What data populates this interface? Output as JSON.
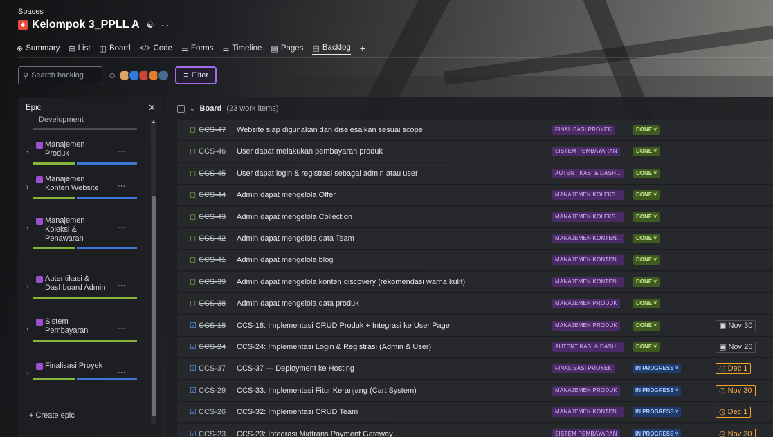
{
  "header": {
    "breadcrumb": "Spaces",
    "project_name": "Kelompok 3_PPLL A",
    "tabs": [
      {
        "label": "Summary",
        "icon": "globe-icon",
        "glyph": "⊕"
      },
      {
        "label": "List",
        "icon": "list-icon",
        "glyph": "⊟"
      },
      {
        "label": "Board",
        "icon": "board-icon",
        "glyph": "◫"
      },
      {
        "label": "Code",
        "icon": "code-icon",
        "glyph": "</>"
      },
      {
        "label": "Forms",
        "icon": "forms-icon",
        "glyph": "☰"
      },
      {
        "label": "Timeline",
        "icon": "timeline-icon",
        "glyph": "☰"
      },
      {
        "label": "Pages",
        "icon": "pages-icon",
        "glyph": "▤"
      },
      {
        "label": "Backlog",
        "icon": "backlog-icon",
        "glyph": "▤"
      }
    ]
  },
  "toolbar": {
    "search_placeholder": "Search backlog",
    "filter_label": "Filter"
  },
  "epic_panel": {
    "title": "Epic",
    "partial_label": "Development",
    "items": [
      {
        "label": "Manajemen Produk",
        "full": false
      },
      {
        "label": "Manajemen Konten Website",
        "full": false
      },
      {
        "label": "Manajemen Koleksi & Penawaran",
        "full": false
      },
      {
        "label": "Autentikasi & Dashboard Admin",
        "full": true
      },
      {
        "label": "Sistem Pembayaran",
        "full": true
      },
      {
        "label": "Finalisasi Proyek",
        "full": false
      }
    ],
    "create_label": "Create epic"
  },
  "board": {
    "title": "Board",
    "count": "(23 work items)",
    "rows": [
      {
        "type": "story",
        "key": "CCS-47",
        "done": true,
        "summary": "Website siap digunakan dan diselesaikan sesuai scope",
        "epic": "FINALISASI PROYEK",
        "status": "DONE",
        "due": "",
        "due_style": ""
      },
      {
        "type": "story",
        "key": "CCS-46",
        "done": true,
        "summary": "User dapat melakukan pembayaran produk",
        "epic": "SISTEM PEMBAYARAN",
        "status": "DONE",
        "due": "",
        "due_style": ""
      },
      {
        "type": "story",
        "key": "CCS-45",
        "done": true,
        "summary": "User dapat login & registrasi sebagai admin atau user",
        "epic": "AUTENTIKASI & DASH...",
        "status": "DONE",
        "due": "",
        "due_style": ""
      },
      {
        "type": "story",
        "key": "CCS-44",
        "done": true,
        "summary": "Admin dapat mengelola Offer",
        "epic": "MANAJEMEN KOLEKS...",
        "status": "DONE",
        "due": "",
        "due_style": ""
      },
      {
        "type": "story",
        "key": "CCS-43",
        "done": true,
        "summary": "Admin dapat mengelola Collection",
        "epic": "MANAJEMEN KOLEKS...",
        "status": "DONE",
        "due": "",
        "due_style": ""
      },
      {
        "type": "story",
        "key": "CCS-42",
        "done": true,
        "summary": "Admin dapat mengelola data Team",
        "epic": "MANAJEMEN KONTEN...",
        "status": "DONE",
        "due": "",
        "due_style": ""
      },
      {
        "type": "story",
        "key": "CCS-41",
        "done": true,
        "summary": "Admin dapat mengelola blog",
        "epic": "MANAJEMEN KONTEN...",
        "status": "DONE",
        "due": "",
        "due_style": ""
      },
      {
        "type": "story",
        "key": "CCS-39",
        "done": true,
        "summary": "Admin dapat mengelola konten discovery (rekomendasi warna kulit)",
        "epic": "MANAJEMEN KONTEN...",
        "status": "DONE",
        "due": "",
        "due_style": ""
      },
      {
        "type": "story",
        "key": "CCS-38",
        "done": true,
        "summary": "Admin dapat mengelola data produk",
        "epic": "MANAJEMEN PRODUK",
        "status": "DONE",
        "due": "",
        "due_style": ""
      },
      {
        "type": "task",
        "key": "CCS-18",
        "done": true,
        "summary": "CCS-18: Implementasi CRUD Produk + Integrasi ke User Page",
        "epic": "MANAJEMEN PRODUK",
        "status": "DONE",
        "due": "Nov 30",
        "due_style": "plain"
      },
      {
        "type": "task",
        "key": "CCS-24",
        "done": true,
        "summary": "CCS-24: Implementasi Login & Registrasi (Admin & User)",
        "epic": "AUTENTIKASI & DASH...",
        "status": "DONE",
        "due": "Nov 26",
        "due_style": "plain"
      },
      {
        "type": "task",
        "key": "CCS-37",
        "done": false,
        "summary": "CCS-37 — Deployment ke Hosting",
        "epic": "FINALISASI PROYEK",
        "status": "IN PROGRESS",
        "due": "Dec 1",
        "due_style": "warn"
      },
      {
        "type": "task",
        "key": "CCS-29",
        "done": false,
        "summary": "CCS-33: Implementasi Fitur Keranjang (Cart System)",
        "epic": "MANAJEMEN PRODUK",
        "status": "IN PROGRESS",
        "due": "Nov 30",
        "due_style": "warn"
      },
      {
        "type": "task",
        "key": "CCS-26",
        "done": false,
        "summary": "CCS-32: Implementasi CRUD Team",
        "epic": "MANAJEMEN KONTEN...",
        "status": "IN PROGRESS",
        "due": "Dec 1",
        "due_style": "warn"
      },
      {
        "type": "task",
        "key": "CCS-23",
        "done": false,
        "summary": "CCS-23: Integrasi Midtrans Payment Gateway",
        "epic": "SISTEM PEMBAYARAN",
        "status": "IN PROGRESS",
        "due": "Nov 30",
        "due_style": "warn"
      }
    ]
  }
}
